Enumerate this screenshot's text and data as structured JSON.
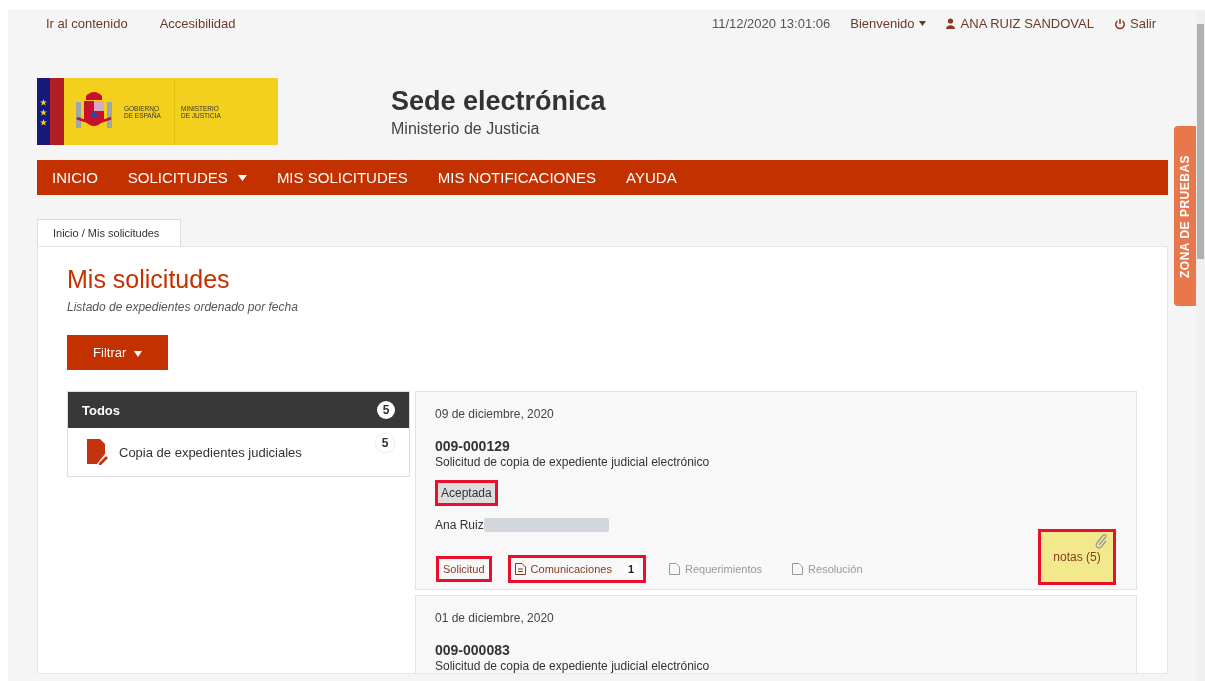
{
  "top_links": [
    "Ir al contenido",
    "Accesibilidad"
  ],
  "datetime": "11/12/2020 13:01:06",
  "welcome_menu": "Bienvenido",
  "user": "ANA RUIZ SANDOVAL",
  "logout": "Salir",
  "logo": {
    "government": [
      "GOBIERNO",
      "DE ESPAÑA"
    ],
    "ministry": [
      "MINISTERIO",
      "DE JUSTICIA"
    ]
  },
  "site": {
    "title": "Sede electrónica",
    "subtitle": "Ministerio de Justicia"
  },
  "nav": [
    {
      "label": "INICIO",
      "dropdown": false
    },
    {
      "label": "SOLICITUDES",
      "dropdown": true
    },
    {
      "label": "MIS SOLICITUDES",
      "dropdown": false
    },
    {
      "label": "MIS NOTIFICACIONES",
      "dropdown": false
    },
    {
      "label": "AYUDA",
      "dropdown": false
    }
  ],
  "breadcrumb": "Inicio / Mis solicitudes",
  "side_tab": "ZONA DE PRUEBAS",
  "page": {
    "title": "Mis solicitudes",
    "subtitle": "Listado de expedientes ordenado por fecha"
  },
  "filter_button": "Filtrar",
  "categories": [
    {
      "label": "Todos",
      "count": "5",
      "selected": true
    },
    {
      "label": "Copia de expedientes judiciales",
      "count": "5",
      "selected": false
    }
  ],
  "requests": [
    {
      "date": "09 de diciembre, 2020",
      "number": "009-000129",
      "description": "Solicitud de copia de expediente judicial electrónico",
      "status": "Aceptada",
      "status_highlighted": true,
      "applicant": "Ana Ruiz",
      "applicant_redacted": true,
      "links": [
        {
          "label": "Solicitud",
          "kind": "plain",
          "enabled": true,
          "highlighted": true
        },
        {
          "label": "Comunicaciones",
          "kind": "doc",
          "enabled": true,
          "highlighted": true,
          "count": "1"
        },
        {
          "label": "Requerimientos",
          "kind": "doc",
          "enabled": false,
          "highlighted": false
        },
        {
          "label": "Resolución",
          "kind": "doc",
          "enabled": false,
          "highlighted": false
        }
      ],
      "notes": {
        "label": "notas (5)",
        "highlighted": true
      }
    },
    {
      "date": "01 de diciembre, 2020",
      "number": "009-000083",
      "description": "Solicitud de copia de expediente judicial electrónico"
    }
  ]
}
